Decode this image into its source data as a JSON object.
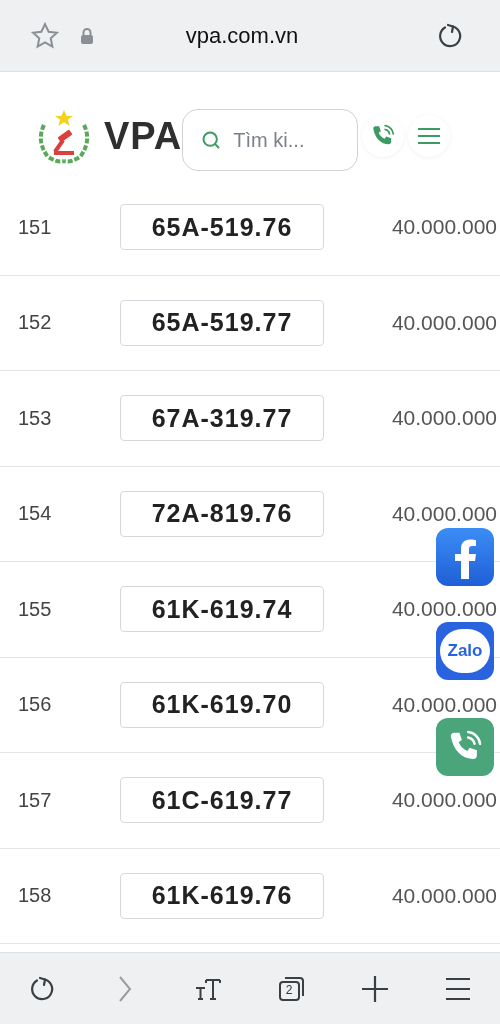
{
  "browser": {
    "url": "vpa.com.vn"
  },
  "header": {
    "logo_text": "VPA",
    "search": {
      "placeholder": "Tìm ki..."
    }
  },
  "rows": [
    {
      "index": "151",
      "plate": "65A-519.76",
      "price": "40.000.000"
    },
    {
      "index": "152",
      "plate": "65A-519.77",
      "price": "40.000.000"
    },
    {
      "index": "153",
      "plate": "67A-319.77",
      "price": "40.000.000"
    },
    {
      "index": "154",
      "plate": "72A-819.76",
      "price": "40.000.000"
    },
    {
      "index": "155",
      "plate": "61K-619.74",
      "price": "40.000.000"
    },
    {
      "index": "156",
      "plate": "61K-619.70",
      "price": "40.000.000"
    },
    {
      "index": "157",
      "plate": "61C-619.77",
      "price": "40.000.000"
    },
    {
      "index": "158",
      "plate": "61K-619.76",
      "price": "40.000.000"
    }
  ],
  "floating": {
    "zalo_label": "Zalo"
  },
  "toolbar": {
    "tab_count": "2"
  }
}
